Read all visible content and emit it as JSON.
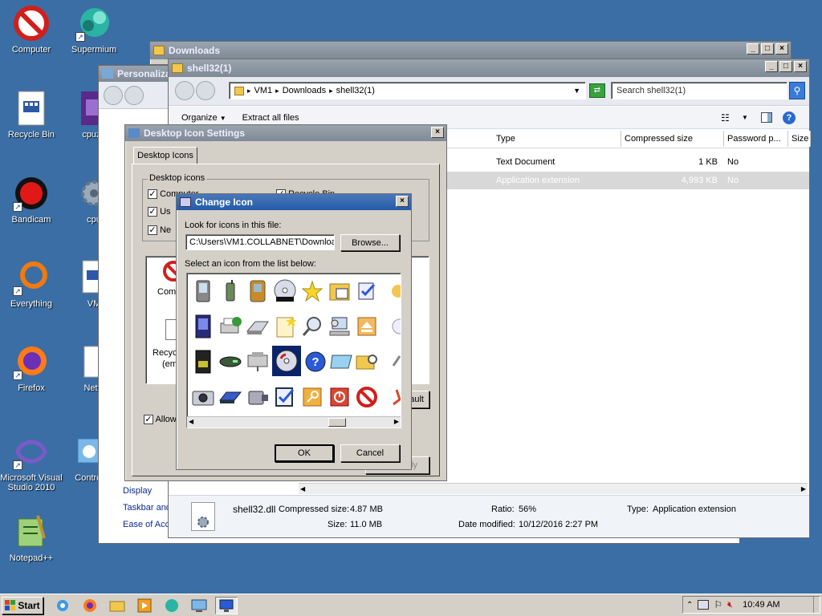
{
  "desktop": {
    "icons": [
      {
        "label": "Computer"
      },
      {
        "label": "Supermium"
      },
      {
        "label": "Recycle Bin"
      },
      {
        "label": "cpuz_"
      },
      {
        "label": "Bandicam"
      },
      {
        "label": "cpu"
      },
      {
        "label": "Everything"
      },
      {
        "label": "VM"
      },
      {
        "label": "Firefox"
      },
      {
        "label": "Netw"
      },
      {
        "label": "Microsoft Visual Studio 2010"
      },
      {
        "label": "Control"
      },
      {
        "label": "Notepad++"
      }
    ]
  },
  "downloads_window": {
    "title": "Downloads"
  },
  "personalization_window": {
    "title": "Personaliza",
    "links": [
      "Display",
      "Taskbar and",
      "Ease of Acc"
    ]
  },
  "shell_window": {
    "title": "shell32(1)",
    "breadcrumb": [
      "VM1",
      "Downloads",
      "shell32(1)"
    ],
    "search_placeholder": "Search shell32(1)",
    "toolbar": {
      "organize": "Organize",
      "extract": "Extract all files"
    },
    "columns": [
      "Type",
      "Compressed size",
      "Password p...",
      "Size"
    ],
    "rows": [
      {
        "type": "Text Document",
        "compressed": "1 KB",
        "password": "No"
      },
      {
        "type": "Application extension",
        "compressed": "4,993 KB",
        "password": "No"
      }
    ],
    "details": {
      "filename": "shell32.dll",
      "compressed_label": "Compressed size:",
      "compressed_value": "4.87 MB",
      "size_label": "Size:",
      "size_value": "11.0 MB",
      "ratio_label": "Ratio:",
      "ratio_value": "56%",
      "modified_label": "Date modified:",
      "modified_value": "10/12/2016 2:27 PM",
      "type_label": "Type:",
      "type_value": "Application extension"
    }
  },
  "desktop_icon_settings": {
    "title": "Desktop Icon Settings",
    "tab": "Desktop Icons",
    "group_label": "Desktop icons",
    "checks": [
      {
        "label": "Computer",
        "checked": true
      },
      {
        "label": "Recycle Bin",
        "checked": true
      },
      {
        "label": "Us",
        "checked": true
      },
      {
        "label": "Ne",
        "checked": true
      }
    ],
    "preview_labels": [
      "Comp",
      "Recycl",
      "(emp"
    ],
    "allow_label": "Allow",
    "restore_label": "ault",
    "apply_label": "ply"
  },
  "change_icon": {
    "title": "Change Icon",
    "look_label": "Look for icons in this file:",
    "path": "C:\\Users\\VM1.COLLABNET\\Download",
    "browse": "Browse...",
    "select_label": "Select an icon from the list below:",
    "ok": "OK",
    "cancel": "Cancel"
  },
  "taskbar": {
    "start": "Start",
    "time": "10:49 AM"
  }
}
